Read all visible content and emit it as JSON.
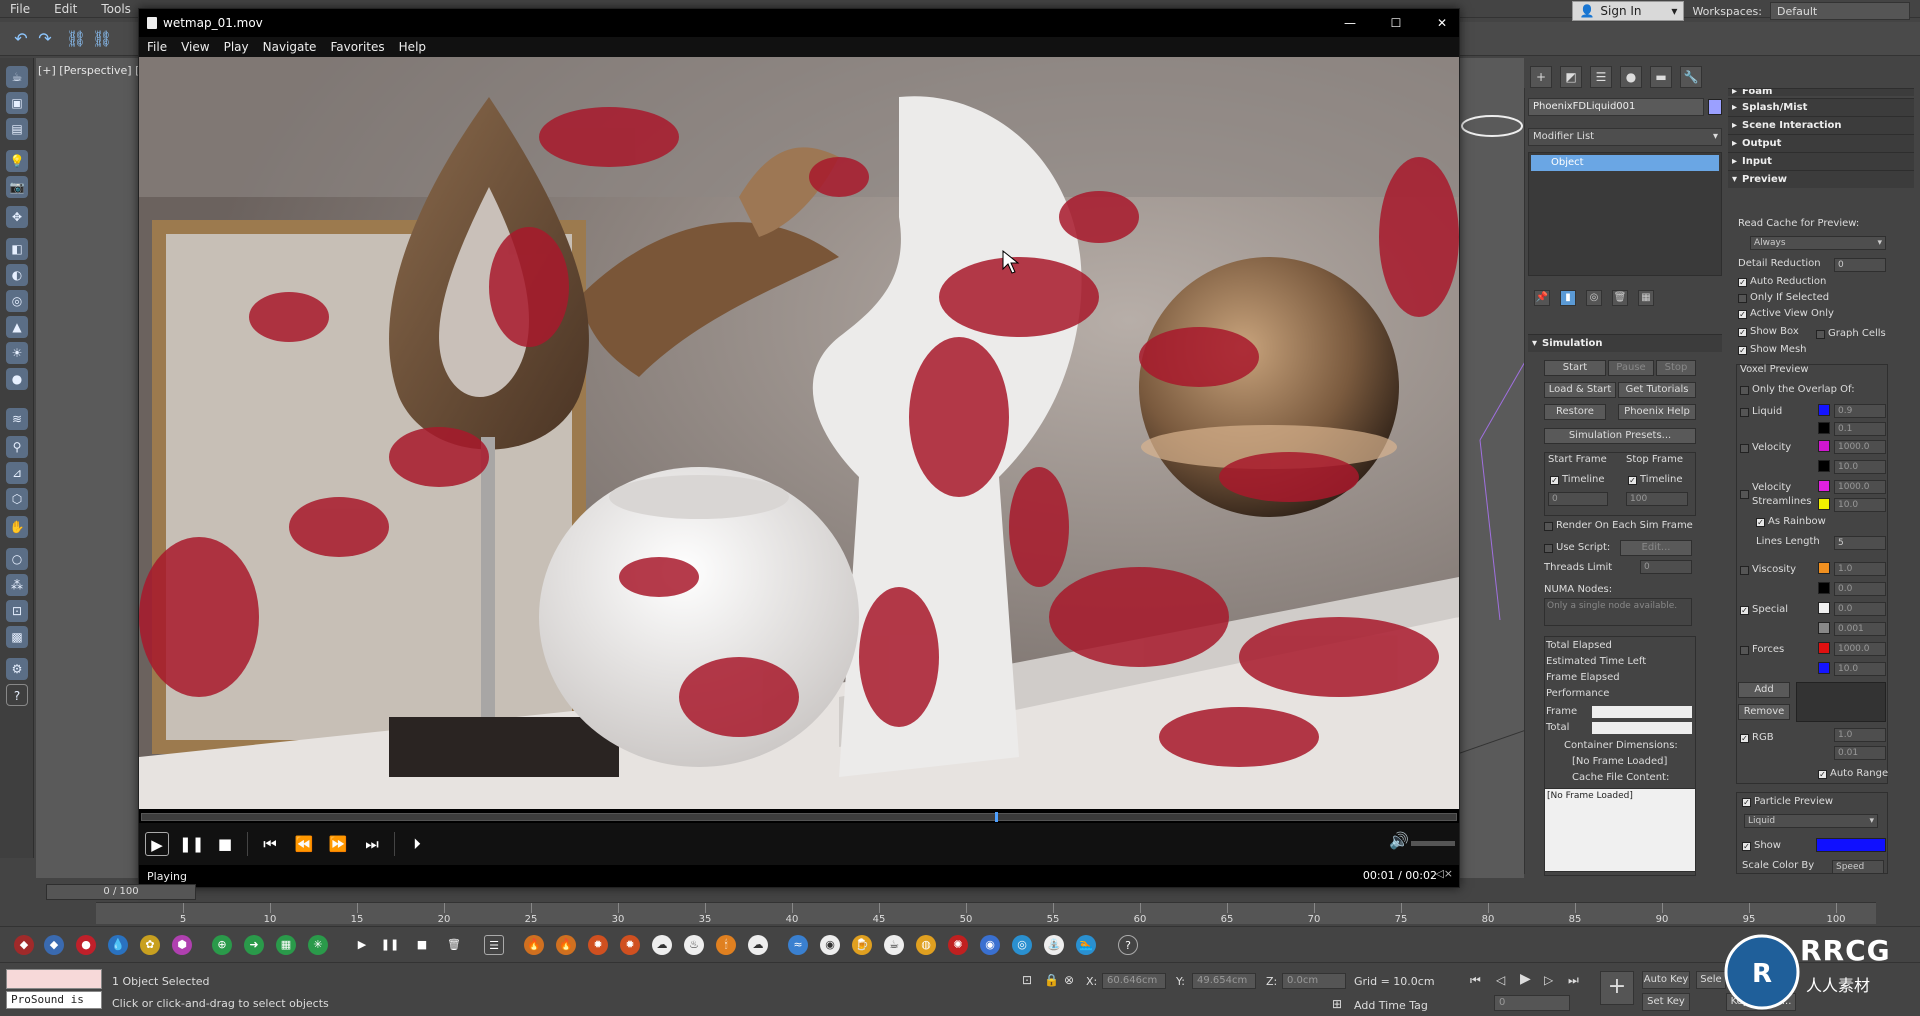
{
  "app": {
    "menu": [
      "File",
      "Edit",
      "Tools"
    ],
    "sign_in": "Sign In",
    "workspaces_label": "Workspaces:",
    "workspace": "Default",
    "viewport_label": "[+] [Perspective] ["
  },
  "player": {
    "title": "wetmap_01.mov",
    "menu": [
      "File",
      "View",
      "Play",
      "Navigate",
      "Favorites",
      "Help"
    ],
    "status": "Playing",
    "time": "00:01 / 00:02",
    "progress": 0.65
  },
  "command_panel": {
    "object_name": "PhoenixFDLiquid001",
    "modifier_list": "Modifier List",
    "stack_item": "Object",
    "object_color": "#9ba0ff"
  },
  "simulation": {
    "title": "Simulation",
    "start": "Start",
    "pause": "Pause",
    "stop": "Stop",
    "load_start": "Load & Start",
    "get_tutorials": "Get Tutorials",
    "restore": "Restore",
    "phoenix_help": "Phoenix Help",
    "presets": "Simulation Presets...",
    "start_frame": "Start Frame",
    "stop_frame": "Stop Frame",
    "timeline": "Timeline",
    "start_val": "0",
    "stop_val": "100",
    "render_each": "Render On Each Sim Frame",
    "use_script": "Use Script:",
    "edit": "Edit...",
    "threads_limit": "Threads Limit",
    "threads_val": "0",
    "numa_nodes": "NUMA Nodes:",
    "numa_placeholder": "Only a single node available.",
    "total_elapsed": "Total Elapsed",
    "est_time_left": "Estimated Time Left",
    "frame_elapsed": "Frame Elapsed",
    "performance": "Performance",
    "frame": "Frame",
    "total": "Total",
    "container_dims": "Container Dimensions:",
    "no_frame": "[No Frame Loaded]",
    "cache_content": "Cache File Content:",
    "cache_box": "[No Frame Loaded]"
  },
  "right_col": {
    "foam": "Foam",
    "splash": "Splash/Mist",
    "scene_interaction": "Scene Interaction",
    "output": "Output",
    "input": "Input",
    "preview": "Preview",
    "read_cache": "Read Cache for Preview:",
    "always": "Always",
    "detail_reduction": "Detail Reduction",
    "detail_val": "0",
    "auto_reduction": "Auto Reduction",
    "only_if_selected": "Only If Selected",
    "active_view_only": "Active View Only",
    "show_box": "Show Box",
    "graph_cells": "Graph Cells",
    "show_mesh": "Show Mesh",
    "voxel_preview": "Voxel Preview",
    "only_overlap": "Only the Overlap Of:",
    "liquid": "Liquid",
    "liquid_v1": "0.9",
    "liquid_v2": "0.1",
    "velocity": "Velocity",
    "vel_v1": "1000.0",
    "vel_v2": "10.0",
    "velocity_streamlines_1": "Velocity",
    "velocity_streamlines_2": "Streamlines",
    "vs_v1": "1000.0",
    "vs_v2": "10.0",
    "as_rainbow": "As Rainbow",
    "lines_length": "Lines Length",
    "lines_val": "5",
    "viscosity": "Viscosity",
    "visc_v1": "1.0",
    "visc_v2": "0.0",
    "special": "Special",
    "spec_v1": "0.0",
    "spec_v2": "0.001",
    "forces": "Forces",
    "forces_v1": "1000.0",
    "forces_v2": "10.0",
    "add": "Add",
    "remove": "Remove",
    "rgb": "RGB",
    "rgb_v1": "1.0",
    "rgb_v2": "0.01",
    "auto_range": "Auto Range",
    "particle_preview": "Particle Preview",
    "particle_liquid": "Liquid",
    "show": "Show",
    "scale_color_by": "Scale Color By",
    "speed": "Speed"
  },
  "timeline": {
    "slider": "0 / 100",
    "ticks": [
      "5",
      "10",
      "15",
      "20",
      "25",
      "30",
      "35",
      "40",
      "45",
      "50",
      "55",
      "60",
      "65",
      "70",
      "75",
      "80",
      "85",
      "90",
      "95",
      "100"
    ]
  },
  "status": {
    "maxscript": "ProSound is",
    "selected": "1 Object Selected",
    "hint": "Click or click-and-drag to select objects",
    "x_label": "X:",
    "x_val": "60.646cm",
    "y_label": "Y:",
    "y_val": "49.654cm",
    "z_label": "Z:",
    "z_val": "0.0cm",
    "grid": "Grid = 10.0cm",
    "add_time_tag": "Add Time Tag",
    "auto_key": "Auto Key",
    "set_key": "Set Key",
    "selected_btn": "Sele",
    "key_filters": "Key Filters...",
    "frame_val": "0"
  },
  "watermark": {
    "brand": "RRCG",
    "sub": "人人素材"
  }
}
